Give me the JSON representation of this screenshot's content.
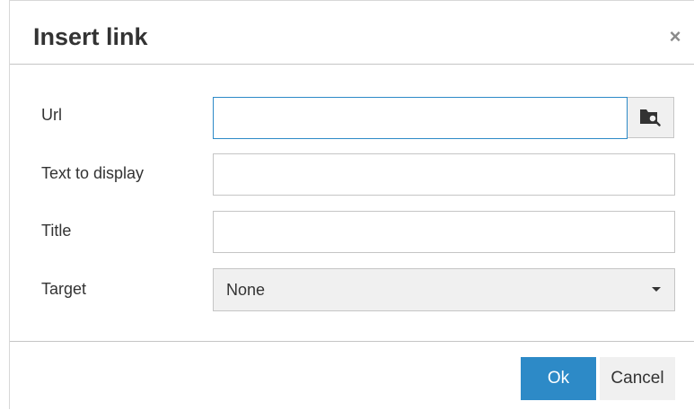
{
  "dialog": {
    "title": "Insert link",
    "close_icon": "close-icon"
  },
  "form": {
    "url": {
      "label": "Url",
      "value": "",
      "placeholder": "",
      "browse_icon": "folder-search-icon"
    },
    "text_to_display": {
      "label": "Text to display",
      "value": "",
      "placeholder": ""
    },
    "title": {
      "label": "Title",
      "value": "",
      "placeholder": ""
    },
    "target": {
      "label": "Target",
      "selected": "None",
      "caret_icon": "caret-down-icon"
    }
  },
  "footer": {
    "ok_label": "Ok",
    "cancel_label": "Cancel"
  },
  "colors": {
    "primary": "#2d8ac7",
    "border": "#c5c5c5",
    "secondary_bg": "#f0f0f0",
    "text": "#333333"
  }
}
